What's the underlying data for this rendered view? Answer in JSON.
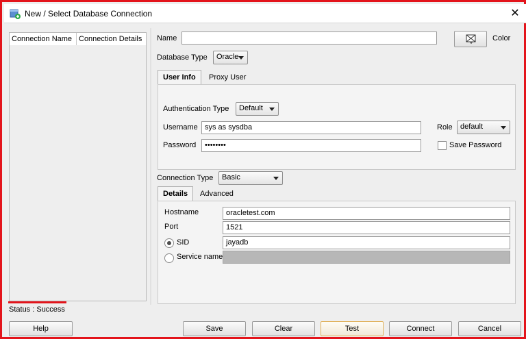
{
  "window": {
    "title": "New / Select Database Connection"
  },
  "connections_table": {
    "columns": [
      "Connection Name",
      "Connection Details"
    ]
  },
  "form": {
    "name_label": "Name",
    "name_value": "",
    "color_label": "Color",
    "database_type_label": "Database Type",
    "database_type_value": "Oracle",
    "tabs": [
      "User Info",
      "Proxy User"
    ],
    "auth_type_label": "Authentication Type",
    "auth_type_value": "Default",
    "username_label": "Username",
    "username_value": "sys as sysdba",
    "password_label": "Password",
    "password_value": "••••••••",
    "role_label": "Role",
    "role_value": "default",
    "save_password_label": "Save Password",
    "connection_type_label": "Connection Type",
    "connection_type_value": "Basic",
    "details_tabs": [
      "Details",
      "Advanced"
    ],
    "hostname_label": "Hostname",
    "hostname_value": "oracletest.com",
    "port_label": "Port",
    "port_value": "1521",
    "sid_label": "SID",
    "sid_value": "jayadb",
    "service_name_label": "Service name",
    "service_name_value": ""
  },
  "status": "Status : Success",
  "buttons": {
    "help": "Help",
    "save": "Save",
    "clear": "Clear",
    "test": "Test",
    "connect": "Connect",
    "cancel": "Cancel"
  }
}
